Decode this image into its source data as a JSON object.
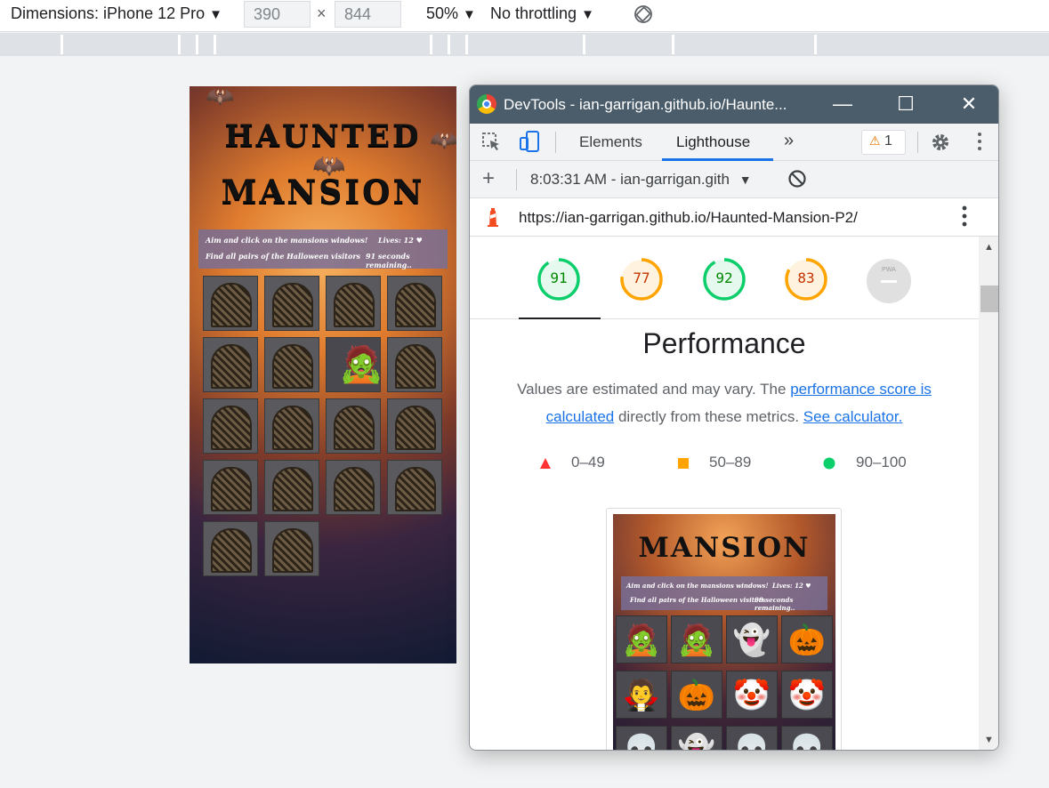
{
  "device_toolbar": {
    "dimensions_label": "Dimensions: iPhone 12 Pro",
    "width_value": "390",
    "times_symbol": "×",
    "height_value": "844",
    "zoom_label": "50%",
    "throttling_label": "No throttling",
    "dropdown_arrow": "▼"
  },
  "game": {
    "title_line1": "HAUNTED",
    "title_line2": "MANSION",
    "instruction": "Aim and click on the mansions windows!",
    "lives": "Lives: 12 ♥",
    "goal": "Find all pairs of the Halloween visitors",
    "timer": "91 seconds remaining..",
    "revealed_card": "mummy"
  },
  "devtools": {
    "window_title": "DevTools - ian-garrigan.github.io/Haunte...",
    "window_buttons": {
      "minimize": "—",
      "maximize": "☐",
      "close": "✕"
    },
    "tabs": [
      {
        "label": "Elements",
        "active": false
      },
      {
        "label": "Lighthouse",
        "active": true
      }
    ],
    "more_tabs": "»",
    "warning_count": "1",
    "report_selector": "8:03:31 AM - ian-garrigan.gith",
    "report_url": "https://ian-garrigan.github.io/Haunted-Mansion-P2/",
    "scores": [
      {
        "value": "91",
        "score": 91,
        "status": "pass",
        "color": "#0cce6b",
        "text_color": "#008800"
      },
      {
        "value": "77",
        "score": 77,
        "status": "average",
        "color": "#ffa400",
        "text_color": "#c33300"
      },
      {
        "value": "92",
        "score": 92,
        "status": "pass",
        "color": "#0cce6b",
        "text_color": "#008800"
      },
      {
        "value": "83",
        "score": 83,
        "status": "average",
        "color": "#ffa400",
        "text_color": "#c33300"
      }
    ],
    "pwa_label": "PWA",
    "section_title": "Performance",
    "description_prefix": "Values are estimated and may vary. The ",
    "description_link1": "performance score is calculated",
    "description_middle": " directly from these metrics. ",
    "description_link2": "See calculator.",
    "legend": [
      {
        "range": "0–49",
        "shape": "triangle",
        "color": "#ff3333"
      },
      {
        "range": "50–89",
        "shape": "square",
        "color": "#ffa400"
      },
      {
        "range": "90–100",
        "shape": "circle",
        "color": "#0cce6b"
      }
    ],
    "screenshot": {
      "title": "MANSION",
      "instruction": "Aim and click on the mansions windows!",
      "lives": "Lives: 12 ♥",
      "goal": "Find all pairs of the Halloween visitors",
      "timer": "98 seconds remaining..",
      "tiles": [
        "mummy",
        "mummy",
        "ghost",
        "jack-o-lantern",
        "vampire",
        "jack-o-lantern",
        "clown",
        "clown",
        "grim-reaper",
        "ghost",
        "grim-reaper",
        "skeleton"
      ]
    }
  }
}
